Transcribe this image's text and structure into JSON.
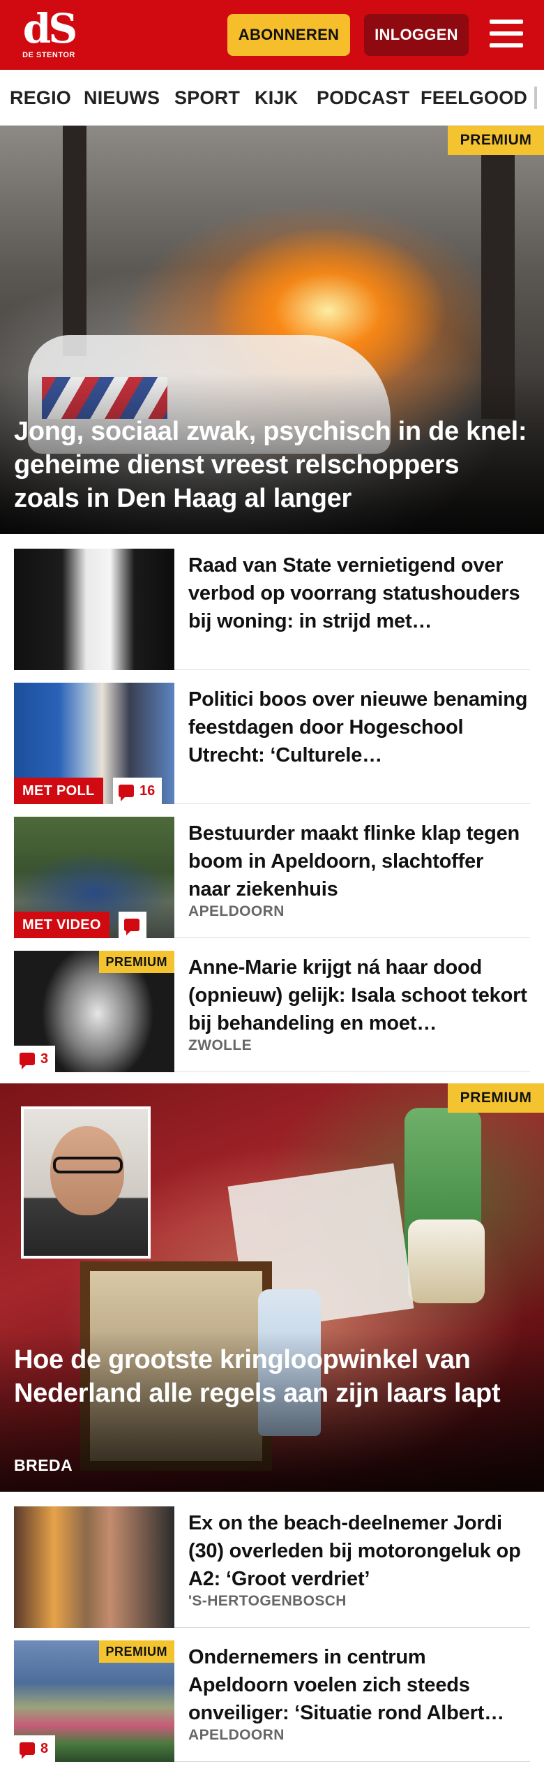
{
  "header": {
    "logo_mark": "dS",
    "logo_text": "DE STENTOR",
    "subscribe_label": "ABONNEREN",
    "login_label": "INLOGGEN",
    "colors": {
      "brand_red": "#d10a11",
      "login_dark_red": "#8f0a10",
      "premium_yellow": "#f4c430",
      "subscribe_yellow": "#f6be2a"
    }
  },
  "nav": {
    "items": [
      {
        "label": "REGIO"
      },
      {
        "label": "NIEUWS"
      },
      {
        "label": "SPORT"
      },
      {
        "label": "KIJK"
      },
      {
        "label": "PODCAST"
      },
      {
        "label": "FEELGOOD"
      }
    ]
  },
  "hero1": {
    "badge": "PREMIUM",
    "title": "Jong, sociaal zwak, psychisch in de knel: geheime dienst vreest relschop­pers zoals in Den Haag al langer"
  },
  "articles1": [
    {
      "title": "Raad van State vernietigend over verbod op voorrang statushou­ders bij woning: in strijd met…",
      "location": "",
      "tag": "",
      "comments": "",
      "premium": ""
    },
    {
      "title": "Politici boos over nieuwe benaming feestdagen door Hogeschool Utrecht: ‘Culturele…",
      "location": "",
      "tag": "MET POLL",
      "comments": "16",
      "premium": ""
    },
    {
      "title": "Bestuurder maakt flinke klap tegen boom in Apeldoorn, slachtoffer naar ziekenhuis",
      "location": "APELDOORN",
      "tag": "MET VIDEO",
      "comments": "",
      "premium": ""
    },
    {
      "title": "Anne-Marie krijgt ná haar dood (opnieuw) gelijk: Isala schoot tekort bij behandeling en moet…",
      "location": "ZWOLLE",
      "tag": "",
      "comments": "3",
      "premium": "PREMIUM"
    }
  ],
  "hero2": {
    "badge": "PREMIUM",
    "title": "Hoe de grootste kringloopwinkel van Nederland alle regels aan zijn laars lapt",
    "location": "BREDA"
  },
  "articles2": [
    {
      "title": "Ex on the beach-deelnemer Jordi (30) overleden bij motorongeluk op A2: ‘Groot verdriet’",
      "location": "'S-HERTOGENBOSCH",
      "comments": "",
      "premium": ""
    },
    {
      "title": "Ondernemers in centrum Apeldoorn voelen zich steeds onveiliger: ‘Situatie rond Albert…",
      "location": "APELDOORN",
      "comments": "8",
      "premium": "PREMIUM"
    }
  ]
}
